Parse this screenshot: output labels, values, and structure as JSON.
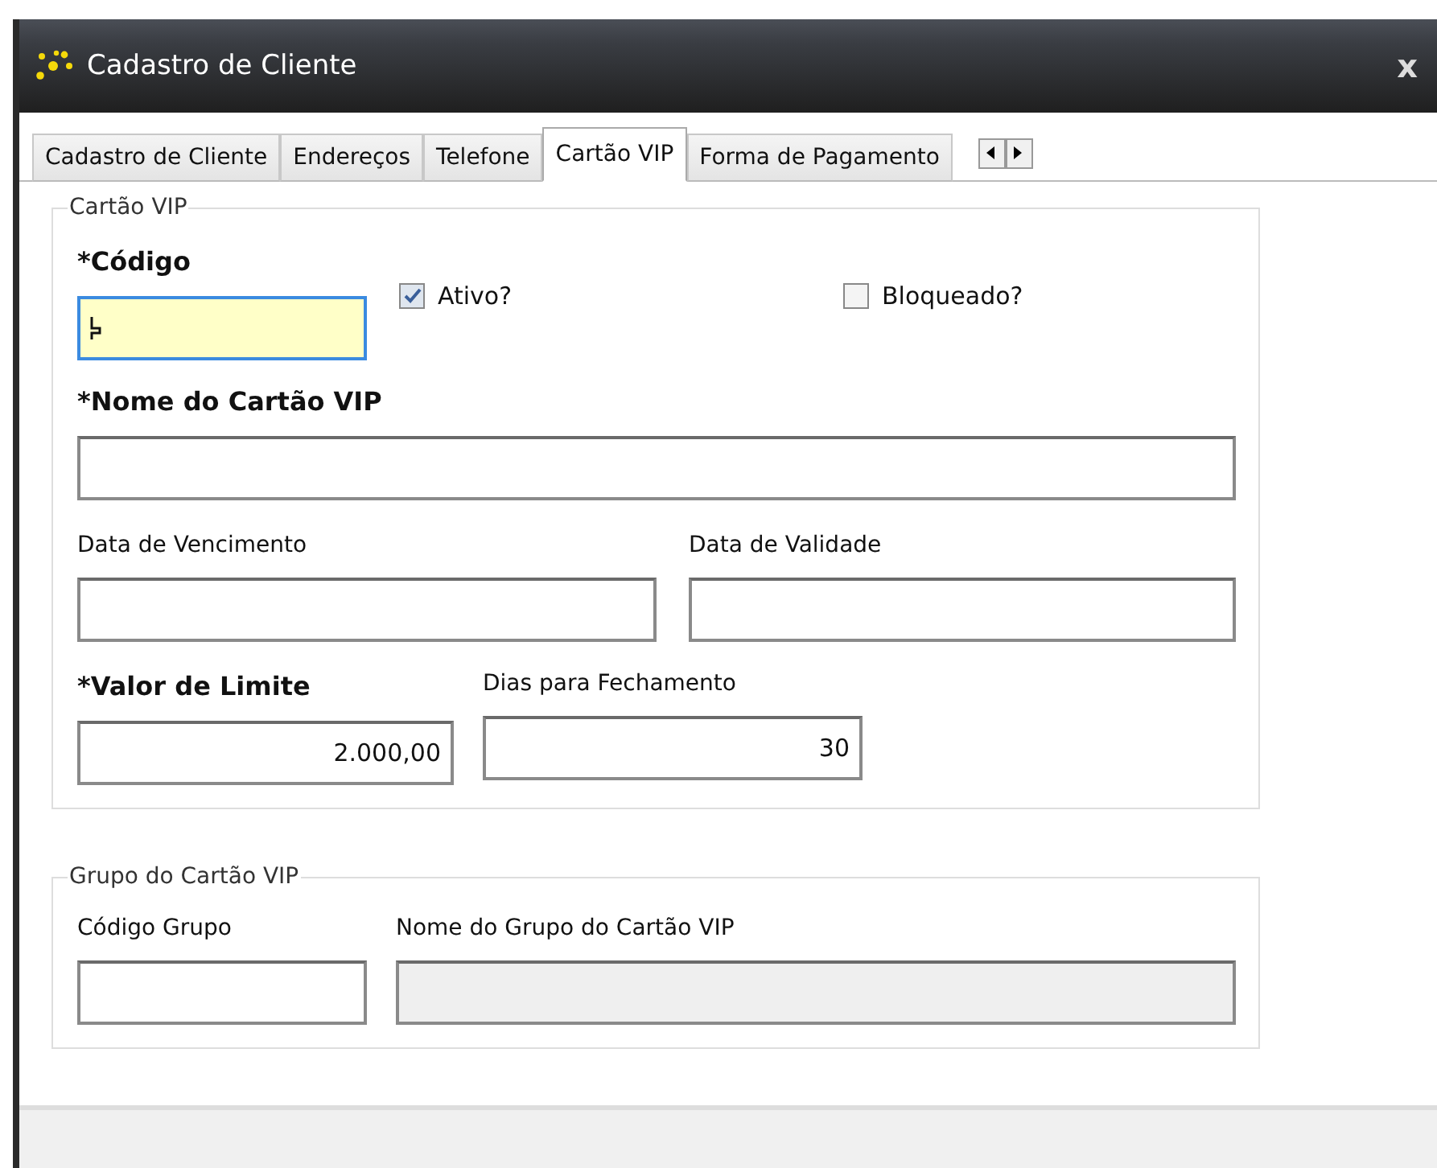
{
  "window": {
    "title": "Cadastro de Cliente",
    "close": "x"
  },
  "tabs": [
    {
      "label": "Cadastro de Cliente",
      "selected": false
    },
    {
      "label": "Endereços",
      "selected": false
    },
    {
      "label": "Telefone",
      "selected": false
    },
    {
      "label": "Cartão VIP",
      "selected": true
    },
    {
      "label": "Forma de Pagamento",
      "selected": false
    }
  ],
  "card_group": {
    "legend": "Cartão VIP",
    "code": {
      "label": "*Código",
      "required": true,
      "focused": true
    },
    "checkboxes": [
      {
        "label": "Ativo?",
        "checked": true
      },
      {
        "label": "Bloqueado?",
        "checked": false
      }
    ],
    "name": {
      "label": "*Nome do Cartão VIP",
      "required": true
    },
    "dates": [
      {
        "label": "Data de Vencimento",
        "required": false
      },
      {
        "label": "Data de Validade",
        "required": false
      }
    ],
    "amounts": [
      {
        "label": "*Valor de Limite",
        "required": true,
        "value": "2.000,00"
      },
      {
        "label": "Dias para Fechamento",
        "required": false,
        "value": "30"
      }
    ]
  },
  "group_group": {
    "legend": "Grupo do Cartão VIP",
    "fields": [
      {
        "label": "Código Grupo",
        "disabled": false
      },
      {
        "label": "Nome do Grupo do Cartão VIP",
        "disabled": true
      }
    ]
  }
}
